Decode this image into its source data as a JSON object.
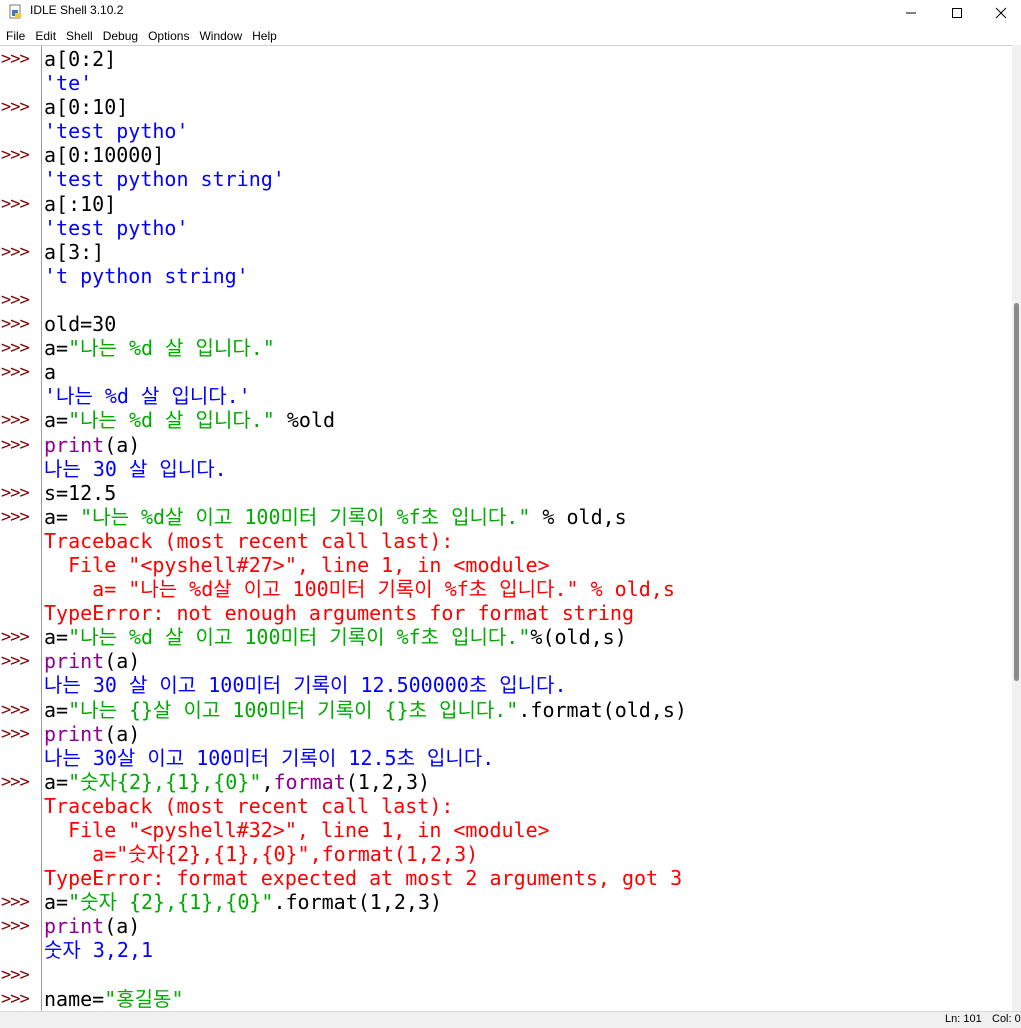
{
  "window": {
    "title": "IDLE Shell 3.10.2"
  },
  "menu": [
    "File",
    "Edit",
    "Shell",
    "Debug",
    "Options",
    "Window",
    "Help"
  ],
  "prompt": ">>>",
  "lines": [
    {
      "p": true,
      "segs": [
        {
          "t": "a[0:2]",
          "c": "in"
        }
      ]
    },
    {
      "p": false,
      "segs": [
        {
          "t": "'te'",
          "c": "out"
        }
      ]
    },
    {
      "p": true,
      "segs": [
        {
          "t": "a[0:10]",
          "c": "in"
        }
      ]
    },
    {
      "p": false,
      "segs": [
        {
          "t": "'test pytho'",
          "c": "out"
        }
      ]
    },
    {
      "p": true,
      "segs": [
        {
          "t": "a[0:10000]",
          "c": "in"
        }
      ]
    },
    {
      "p": false,
      "segs": [
        {
          "t": "'test python string'",
          "c": "out"
        }
      ]
    },
    {
      "p": true,
      "segs": [
        {
          "t": "a[:10]",
          "c": "in"
        }
      ]
    },
    {
      "p": false,
      "segs": [
        {
          "t": "'test pytho'",
          "c": "out"
        }
      ]
    },
    {
      "p": true,
      "segs": [
        {
          "t": "a[3:]",
          "c": "in"
        }
      ]
    },
    {
      "p": false,
      "segs": [
        {
          "t": "'t python string'",
          "c": "out"
        }
      ]
    },
    {
      "p": true,
      "segs": []
    },
    {
      "p": true,
      "segs": [
        {
          "t": "old=30",
          "c": "in"
        }
      ]
    },
    {
      "p": true,
      "segs": [
        {
          "t": "a=",
          "c": "in"
        },
        {
          "t": "\"나는 %d 살 입니다.\"",
          "c": "str"
        }
      ]
    },
    {
      "p": true,
      "segs": [
        {
          "t": "a",
          "c": "in"
        }
      ]
    },
    {
      "p": false,
      "segs": [
        {
          "t": "'나는 %d 살 입니다.'",
          "c": "out"
        }
      ]
    },
    {
      "p": true,
      "segs": [
        {
          "t": "a=",
          "c": "in"
        },
        {
          "t": "\"나는 %d 살 입니다.\"",
          "c": "str"
        },
        {
          "t": " %old",
          "c": "in"
        }
      ]
    },
    {
      "p": true,
      "segs": [
        {
          "t": "print",
          "c": "bi"
        },
        {
          "t": "(a)",
          "c": "in"
        }
      ]
    },
    {
      "p": false,
      "segs": [
        {
          "t": "나는 30 살 입니다.",
          "c": "out"
        }
      ]
    },
    {
      "p": true,
      "segs": [
        {
          "t": "s=12.5",
          "c": "in"
        }
      ]
    },
    {
      "p": true,
      "segs": [
        {
          "t": "a= ",
          "c": "in"
        },
        {
          "t": "\"나는 %d살 이고 100미터 기록이 %f초 입니다.\"",
          "c": "str"
        },
        {
          "t": " % old,s",
          "c": "in"
        }
      ]
    },
    {
      "p": false,
      "segs": [
        {
          "t": "Traceback (most recent call last):",
          "c": "err"
        }
      ]
    },
    {
      "p": false,
      "segs": [
        {
          "t": "  File \"<pyshell#27>\", line 1, in <module>",
          "c": "err"
        }
      ]
    },
    {
      "p": false,
      "segs": [
        {
          "t": "    a= \"나는 %d살 이고 100미터 기록이 %f초 입니다.\" % old,s",
          "c": "err"
        }
      ]
    },
    {
      "p": false,
      "segs": [
        {
          "t": "TypeError: not enough arguments for format string",
          "c": "err"
        }
      ]
    },
    {
      "p": true,
      "segs": [
        {
          "t": "a=",
          "c": "in"
        },
        {
          "t": "\"나는 %d 살 이고 100미터 기록이 %f초 입니다.\"",
          "c": "str"
        },
        {
          "t": "%(old,s)",
          "c": "in"
        }
      ]
    },
    {
      "p": true,
      "segs": [
        {
          "t": "print",
          "c": "bi"
        },
        {
          "t": "(a)",
          "c": "in"
        }
      ]
    },
    {
      "p": false,
      "segs": [
        {
          "t": "나는 30 살 이고 100미터 기록이 12.500000초 입니다.",
          "c": "out"
        }
      ]
    },
    {
      "p": true,
      "segs": [
        {
          "t": "a=",
          "c": "in"
        },
        {
          "t": "\"나는 {}살 이고 100미터 기록이 {}초 입니다.\"",
          "c": "str"
        },
        {
          "t": ".format(old,s)",
          "c": "in"
        }
      ]
    },
    {
      "p": true,
      "segs": [
        {
          "t": "print",
          "c": "bi"
        },
        {
          "t": "(a)",
          "c": "in"
        }
      ]
    },
    {
      "p": false,
      "segs": [
        {
          "t": "나는 30살 이고 100미터 기록이 12.5초 입니다.",
          "c": "out"
        }
      ]
    },
    {
      "p": true,
      "segs": [
        {
          "t": "a=",
          "c": "in"
        },
        {
          "t": "\"숫자{2},{1},{0}\"",
          "c": "str"
        },
        {
          "t": ",",
          "c": "in"
        },
        {
          "t": "format",
          "c": "bi"
        },
        {
          "t": "(1,2,3)",
          "c": "in"
        }
      ]
    },
    {
      "p": false,
      "segs": [
        {
          "t": "Traceback (most recent call last):",
          "c": "err"
        }
      ]
    },
    {
      "p": false,
      "segs": [
        {
          "t": "  File \"<pyshell#32>\", line 1, in <module>",
          "c": "err"
        }
      ]
    },
    {
      "p": false,
      "segs": [
        {
          "t": "    a=\"숫자{2},{1},{0}\",format(1,2,3)",
          "c": "err"
        }
      ]
    },
    {
      "p": false,
      "segs": [
        {
          "t": "TypeError: format expected at most 2 arguments, got 3",
          "c": "err"
        }
      ]
    },
    {
      "p": true,
      "segs": [
        {
          "t": "a=",
          "c": "in"
        },
        {
          "t": "\"숫자 {2},{1},{0}\"",
          "c": "str"
        },
        {
          "t": ".format(1,2,3)",
          "c": "in"
        }
      ]
    },
    {
      "p": true,
      "segs": [
        {
          "t": "print",
          "c": "bi"
        },
        {
          "t": "(a)",
          "c": "in"
        }
      ]
    },
    {
      "p": false,
      "segs": [
        {
          "t": "숫자 3,2,1",
          "c": "out"
        }
      ]
    },
    {
      "p": true,
      "segs": []
    },
    {
      "p": true,
      "segs": [
        {
          "t": "name=",
          "c": "in"
        },
        {
          "t": "\"홍길동\"",
          "c": "str"
        }
      ]
    }
  ],
  "status": {
    "ln": "Ln: 101",
    "col": "Col: 0"
  },
  "colors": {
    "prompt": "#7f0000",
    "string": "#00aa00",
    "output": "#0000ff",
    "error": "#ff0000",
    "builtin": "#900090"
  }
}
